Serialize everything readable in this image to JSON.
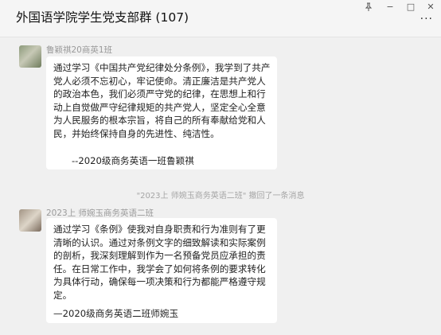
{
  "window": {
    "title": "外国语学院学生党支部群 (107)",
    "controls": {
      "pin": "pin-icon",
      "minimize": "−",
      "maximize": "□",
      "close": "✕",
      "more": "···"
    }
  },
  "messages": [
    {
      "sender": "鲁颖祺20商英1班",
      "text": "通过学习《中国共产党纪律处分条例》，我学到了共产党人必须不忘初心，牢记使命。清正廉洁是共产党人的政治本色，我们必须严守党的纪律，在思想上和行动上自觉做严守纪律规矩的共产党人，坚定全心全意为人民服务的根本宗旨，将自己的所有奉献给党和人民，并始终保持自身的先进性、纯洁性。",
      "signature": "--2020级商务英语一班鲁颖祺"
    },
    {
      "sender": "2023上 师婉玉商务英语二班",
      "text": "通过学习《条例》使我对自身职责和行为准则有了更清晰的认识。通过对条例文字的细致解读和实际案例的剖析，我深刻理解到作为一名预备党员应承担的责任。在日常工作中，我学会了如何将条例的要求转化为具体行动，确保每一项决策和行为都能严格遵守规定。",
      "signature": "—2020级商务英语二班师婉玉"
    }
  ],
  "system_notice": "\"2023上 师婉玉商务英语二班\" 撤回了一条消息"
}
